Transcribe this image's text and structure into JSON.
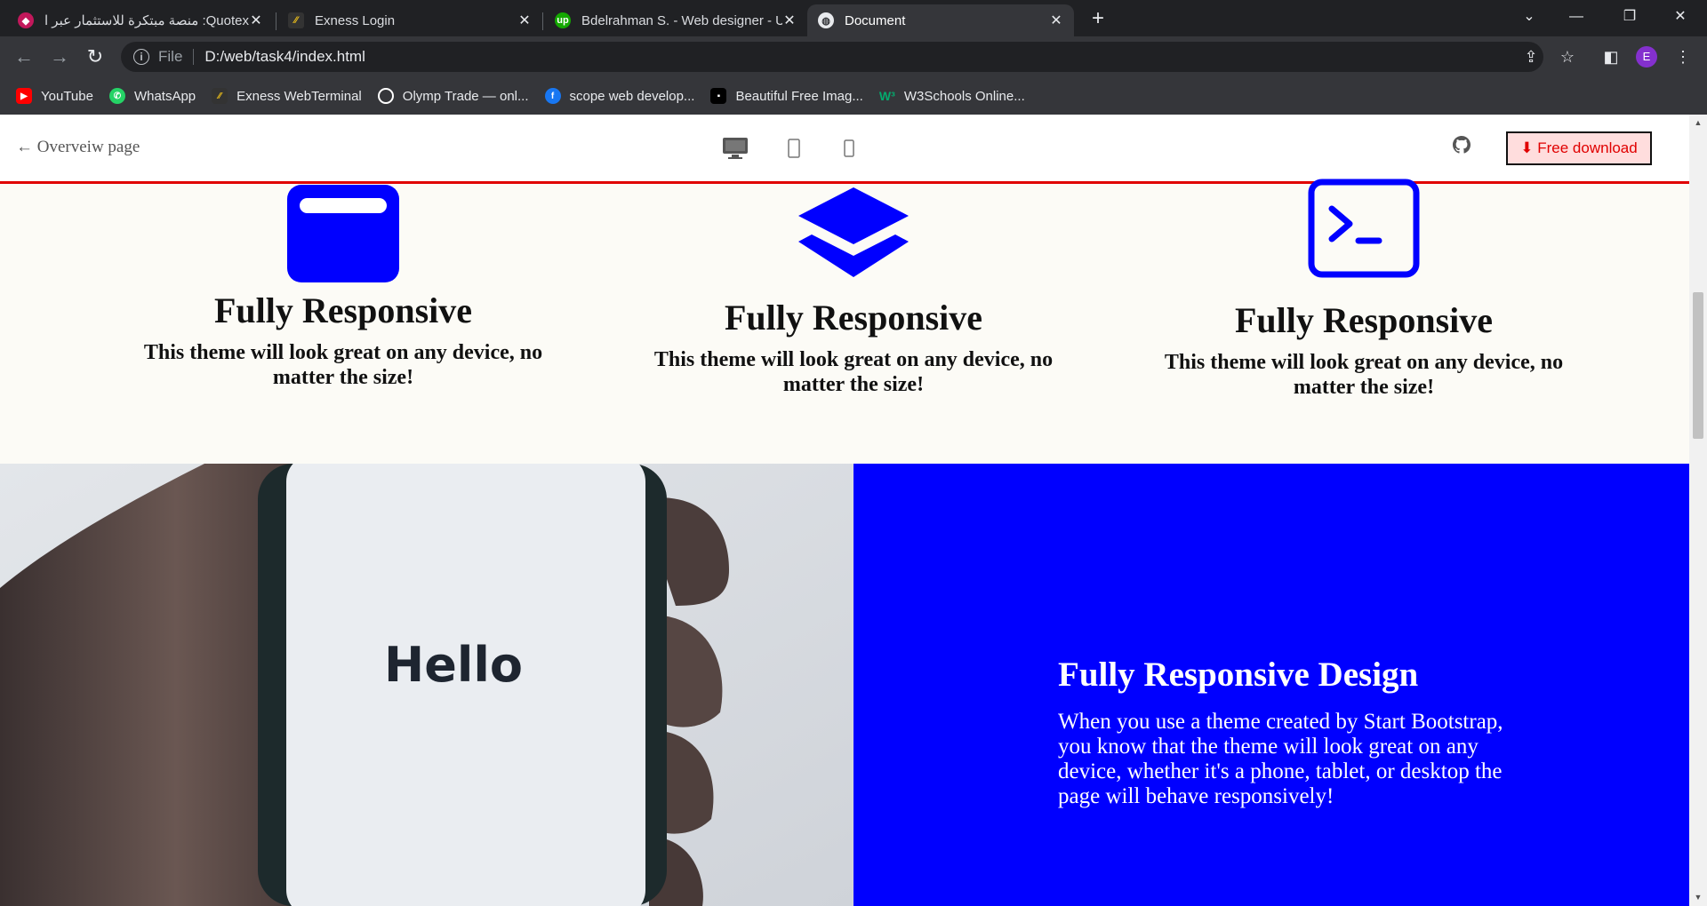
{
  "browser": {
    "tabs": [
      {
        "title": "Quotex: منصة مبتكرة للاستثمار عبر الإنترنت",
        "icon": "quotex-icon",
        "color": "#c2185b"
      },
      {
        "title": "Exness Login",
        "icon": "exness-icon",
        "color": "#f5c518"
      },
      {
        "title": "Bdelrahman S. - Web designer - Upwork",
        "icon": "upwork-icon",
        "color": "#14a800"
      },
      {
        "title": "Document",
        "icon": "globe-icon",
        "color": "#9aa0a6"
      }
    ],
    "address": {
      "scheme_label": "File",
      "url": "D:/web/task4/index.html"
    },
    "profile_initial": "E",
    "bookmarks": [
      {
        "label": "YouTube",
        "icon": "youtube-icon",
        "color": "#ff0000"
      },
      {
        "label": "WhatsApp",
        "icon": "whatsapp-icon",
        "color": "#25d366"
      },
      {
        "label": "Exness WebTerminal",
        "icon": "exness-icon",
        "color": "#f5c518"
      },
      {
        "label": "Olymp Trade — onl...",
        "icon": "olymptrade-icon",
        "color": "#ffffff"
      },
      {
        "label": "scope web develop...",
        "icon": "facebook-icon",
        "color": "#1877f2"
      },
      {
        "label": "Beautiful Free Imag...",
        "icon": "unsplash-icon",
        "color": "#000000"
      },
      {
        "label": "W3Schools Online...",
        "icon": "w3schools-icon",
        "color": "#04aa6d"
      }
    ]
  },
  "site": {
    "back_label": "Overveiw page",
    "download_label": "Free download",
    "accent_color": "#e00000",
    "features": [
      {
        "icon": "window-icon",
        "title": "Fully Responsive",
        "text": "This theme will look great on any device, no matter the size!"
      },
      {
        "icon": "layers-icon",
        "title": "Fully Responsive",
        "text": "This theme will look great on any device, no matter the size!"
      },
      {
        "icon": "terminal-icon",
        "title": "Fully Responsive",
        "text": "This theme will look great on any device, no matter the size!"
      }
    ],
    "hero": {
      "image_text": "Hello",
      "title": "Fully Responsive Design",
      "text": "When you use a theme created by Start Bootstrap, you know that the theme will look great on any device, whether it's a phone, tablet, or desktop the page will behave responsively!",
      "color": "#0000ff"
    }
  }
}
